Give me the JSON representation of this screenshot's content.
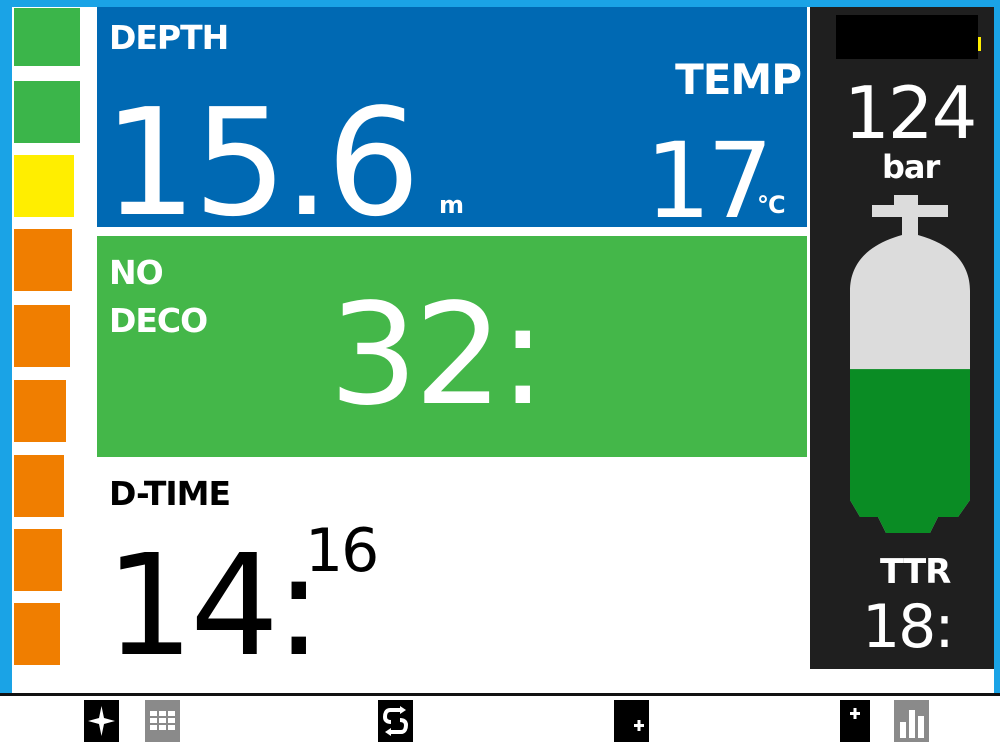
{
  "colors": {
    "frame": "#1aa3e6",
    "depth_panel": "#0069b3",
    "ndl_panel": "#44b749",
    "tank_panel": "#1f1f1f",
    "tank_gas": "#0a8c24",
    "tank_empty": "#dcdcdc",
    "ascent_green": "#3bb54a",
    "ascent_yellow": "#ffee00",
    "ascent_orange": "#f07e00"
  },
  "ascent_bar": {
    "segments": [
      "green",
      "green",
      "yellow",
      "orange",
      "orange",
      "orange",
      "orange",
      "orange",
      "orange"
    ]
  },
  "depth": {
    "label": "DEPTH",
    "value": "15.6",
    "unit": "m"
  },
  "temp": {
    "label": "TEMP",
    "value": "17",
    "unit": "°C"
  },
  "ndl": {
    "label_line1": "NO",
    "label_line2": "DECO",
    "value": "32:"
  },
  "dive_time": {
    "label": "D-TIME",
    "minutes": "14:",
    "seconds": "16"
  },
  "tank": {
    "pressure": "124",
    "unit": "bar",
    "fill_fraction": 0.55
  },
  "ttr": {
    "label": "TTR",
    "value": "18:"
  },
  "bottom_icons": [
    "compass-icon",
    "grid-icon",
    "swap-icon",
    "plus-icon",
    "plus-chart-icon"
  ]
}
